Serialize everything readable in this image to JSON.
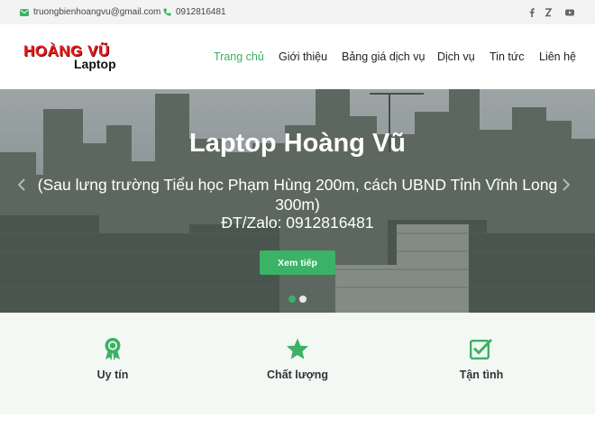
{
  "topbar": {
    "email": "truongbienhoangvu@gmail.com",
    "phone": "0912816481",
    "icons": [
      "mail-icon",
      "phone-icon",
      "facebook-icon",
      "zalo-icon",
      "youtube-icon"
    ]
  },
  "header": {
    "logo_line1": "HOÀNG VŨ",
    "logo_line2": "Laptop",
    "nav": [
      "Trang chủ",
      "Giới thiệu",
      "Bảng giá dịch vụ",
      "Dịch vụ",
      "Tin tức",
      "Liên hệ"
    ],
    "active_index": 0
  },
  "hero": {
    "title": "Laptop Hoàng Vũ",
    "subtitle": "(Sau lưng trường Tiểu học Phạm Hùng 200m, cách UBND Tỉnh Vĩnh Long 300m)",
    "phone_line": "ĐT/Zalo: 0912816481",
    "button": "Xem tiếp",
    "slide_count": 2,
    "active_slide": 0
  },
  "features": [
    {
      "label": "Uy tín",
      "icon": "award-icon"
    },
    {
      "label": "Chất lượng",
      "icon": "star-icon"
    },
    {
      "label": "Tận tình",
      "icon": "checkbox-icon"
    }
  ],
  "colors": {
    "accent": "#3bb265",
    "topbar_bg": "#f2f3f2",
    "features_bg": "#f4f8f5",
    "logo_red": "#e51c1c"
  }
}
